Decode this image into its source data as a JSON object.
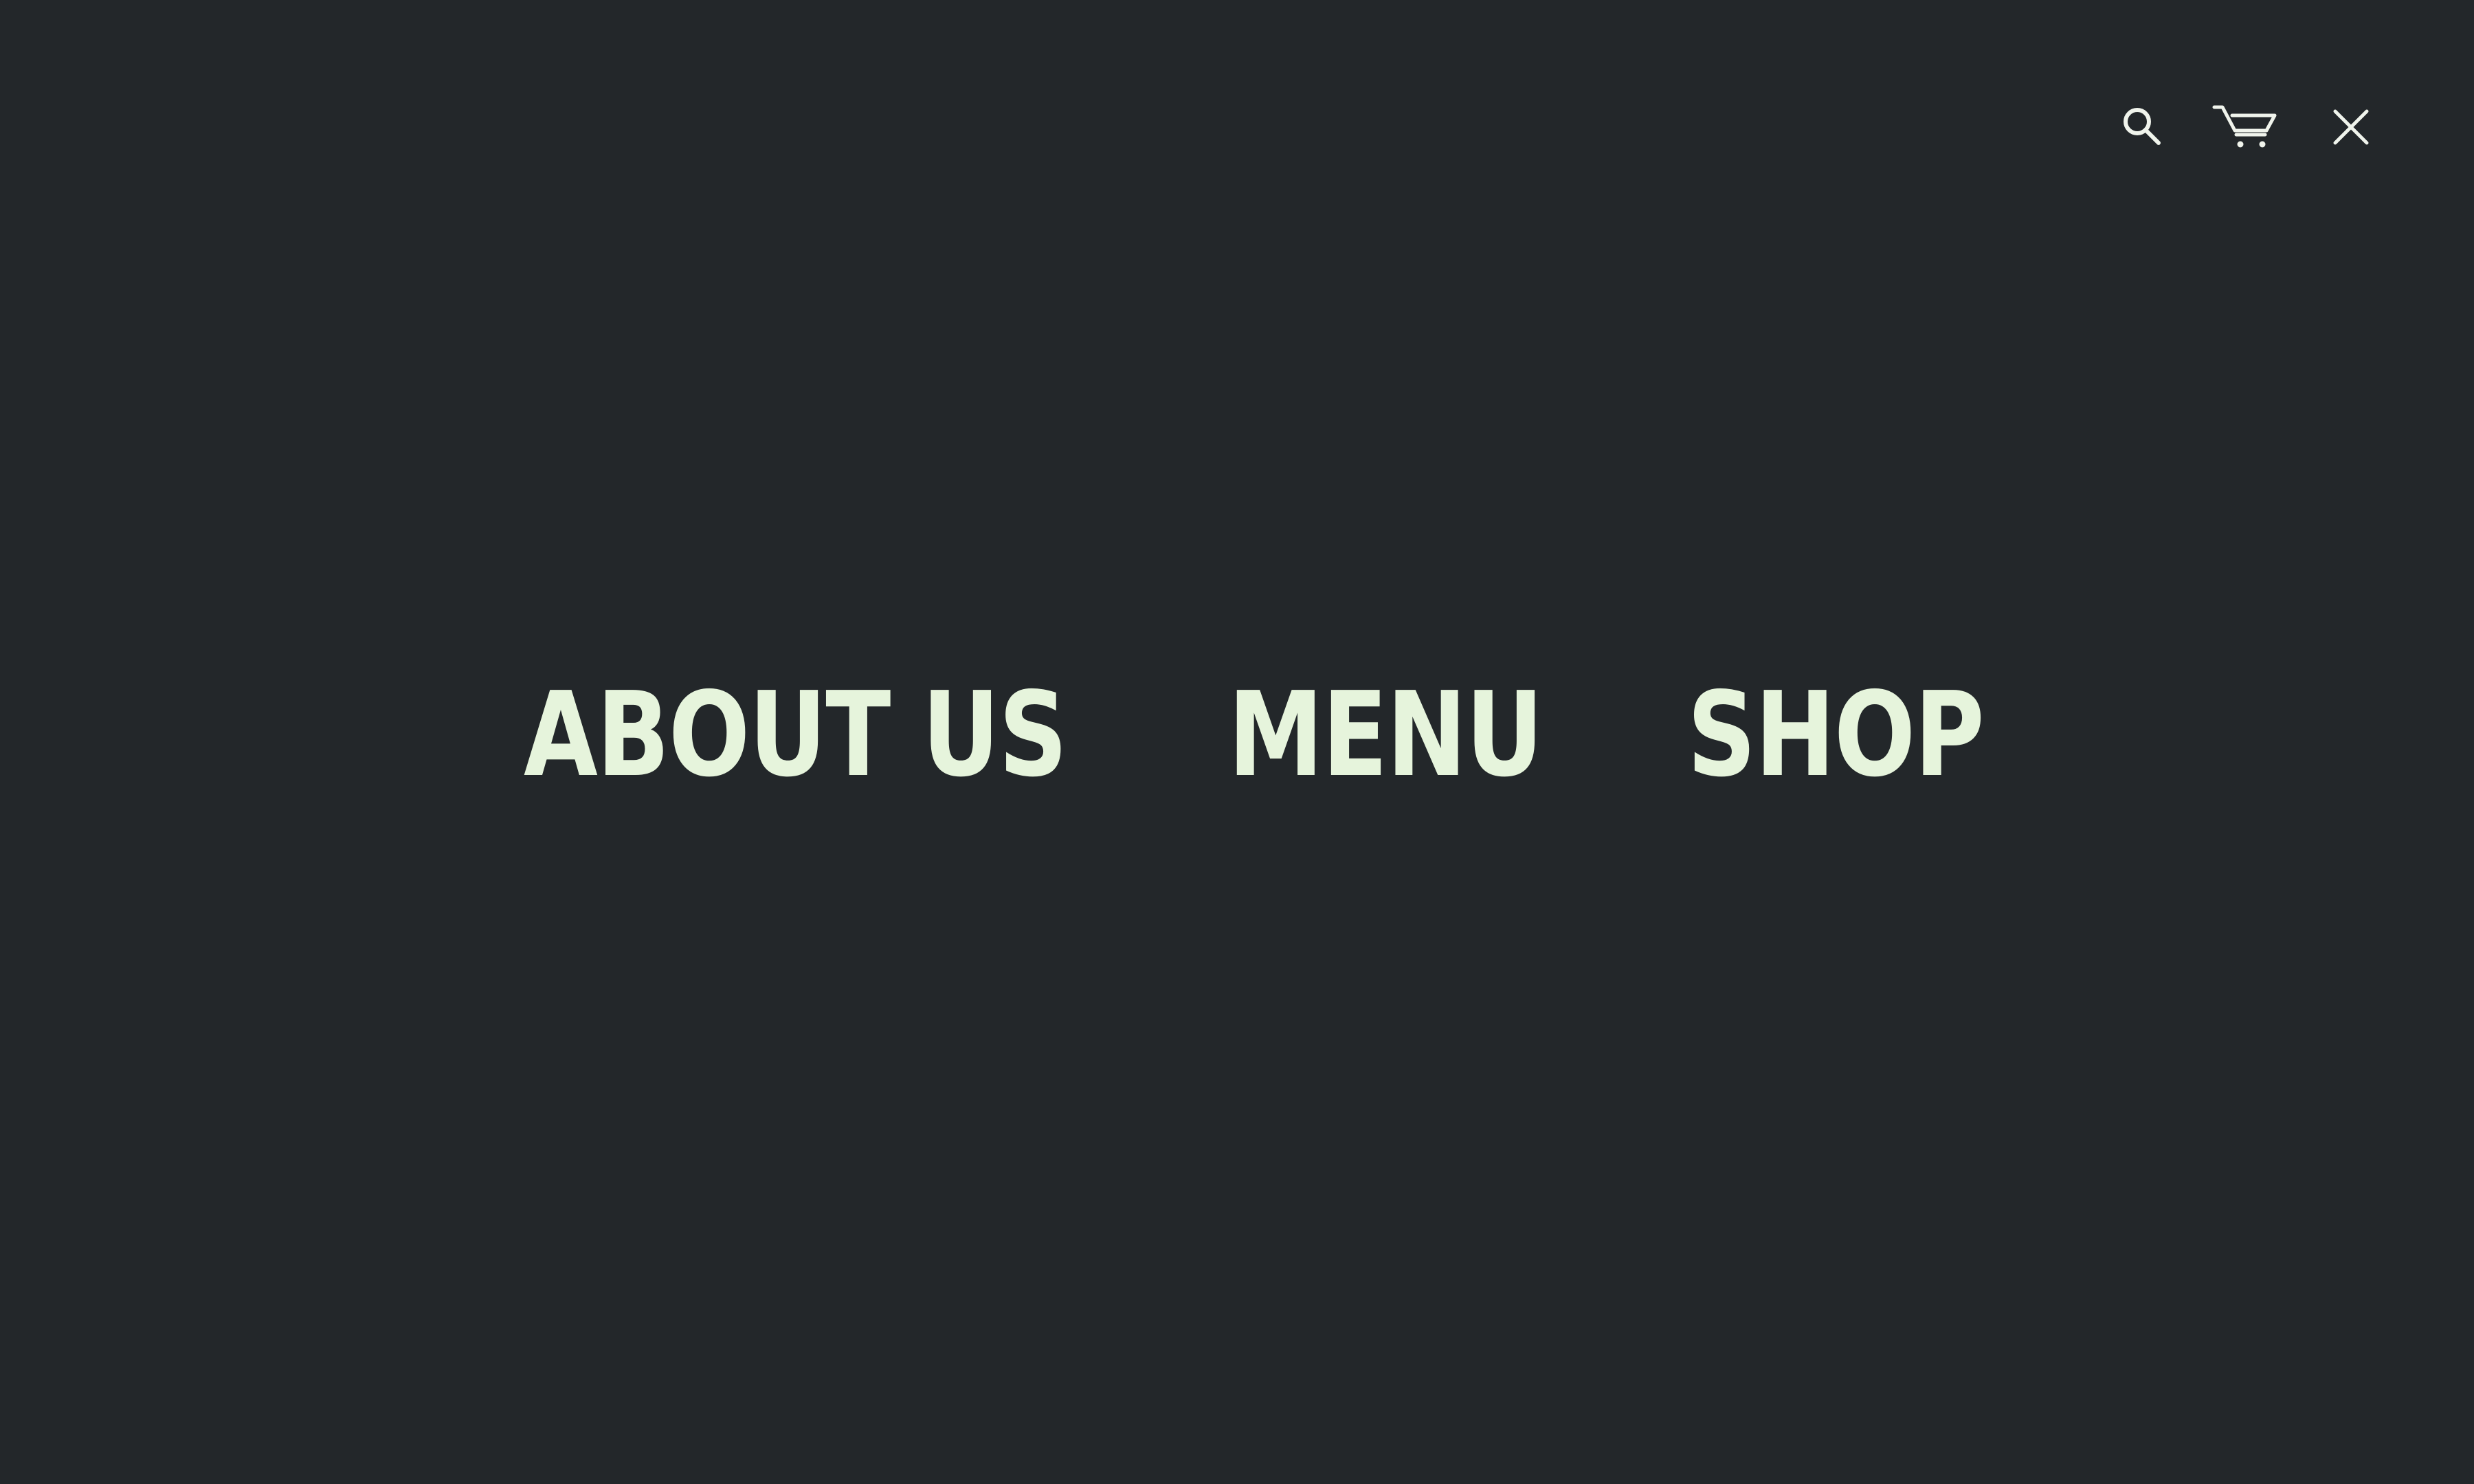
{
  "header": {
    "icons": {
      "search": "search-icon",
      "cart": "shopping-cart-icon",
      "close": "close-icon"
    }
  },
  "nav": {
    "items": [
      {
        "label": "ABOUT US"
      },
      {
        "label": "MENU"
      },
      {
        "label": "SHOP"
      }
    ]
  },
  "colors": {
    "background": "#23272a",
    "accent": "#e6f4dc",
    "icon": "#f0f4ec"
  }
}
